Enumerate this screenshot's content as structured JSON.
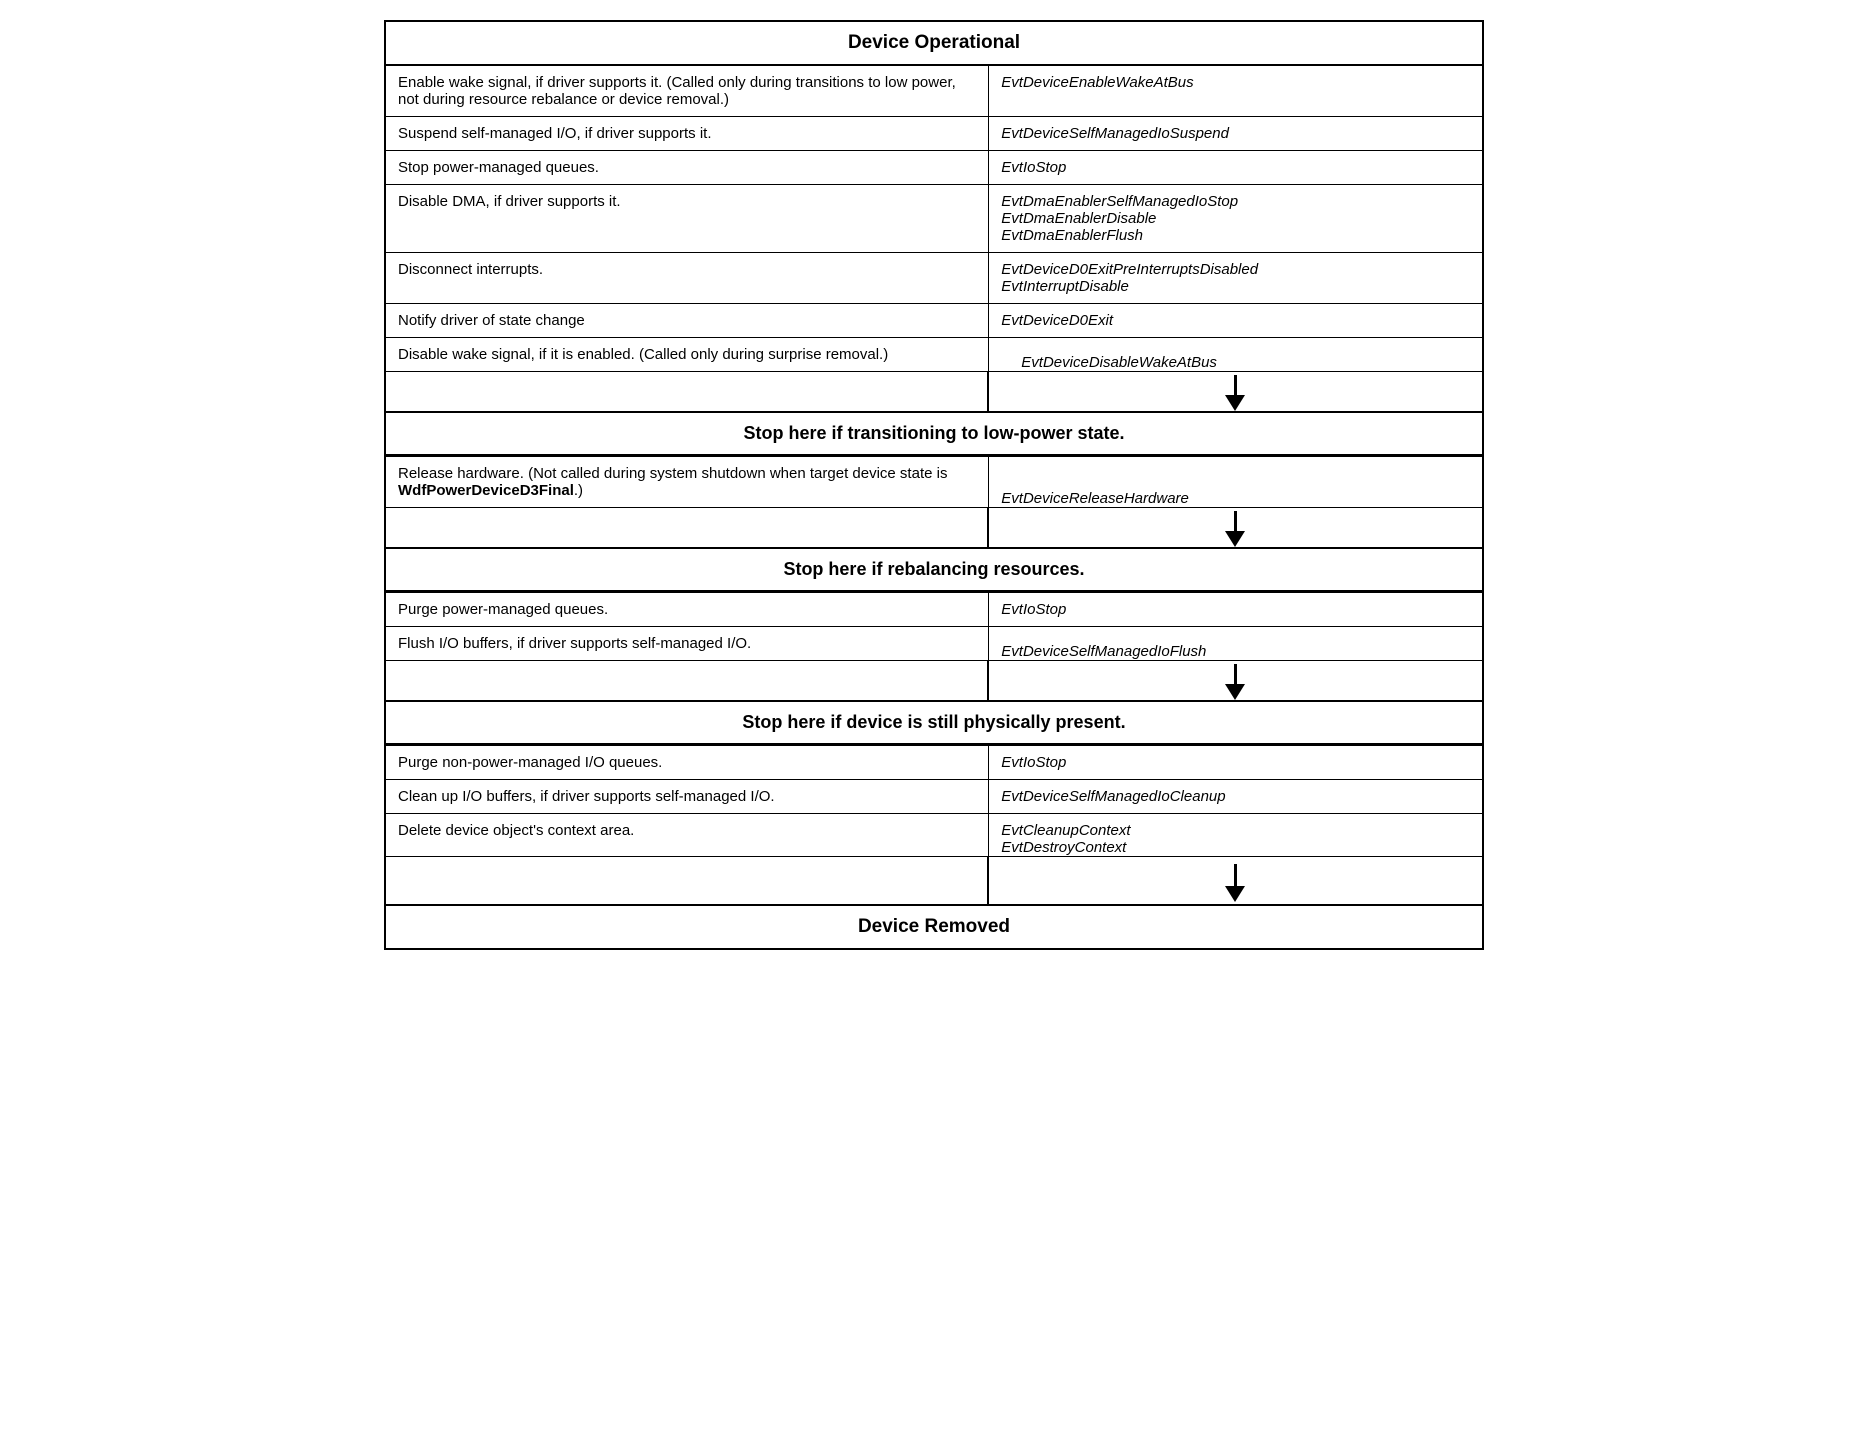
{
  "title": "Device Operational",
  "bottom_title": "Device Removed",
  "sections": {
    "phase1": {
      "rows": [
        {
          "left": "Enable wake signal, if driver supports it. (Called only during transitions to low power, not during resource rebalance or device removal.)",
          "right": "EvtDeviceEnableWakeAtBus",
          "arrow": false
        },
        {
          "left": "Suspend self-managed I/O, if driver supports it.",
          "right": "EvtDeviceSelfManagedIoSuspend",
          "arrow": false
        },
        {
          "left": "Stop power-managed queues.",
          "right": "EvtIoStop",
          "arrow": false
        },
        {
          "left": "Disable DMA, if driver supports it.",
          "right_multi": [
            "EvtDmaEnablerSelfManagedIoStop",
            "EvtDmaEnablerDisable",
            "EvtDmaEnablerFlush"
          ],
          "arrow": false
        },
        {
          "left": "Disconnect interrupts.",
          "right_multi": [
            "EvtDeviceD0ExitPreInterruptsDisabled",
            "EvtInterruptDisable"
          ],
          "arrow": false
        },
        {
          "left": "Notify driver of state change",
          "right": "EvtDeviceD0Exit",
          "arrow": false
        },
        {
          "left": "Disable wake signal, if it is enabled. (Called only during surprise removal.)",
          "right": "EvtDeviceDisableWakeAtBus",
          "arrow": true
        }
      ]
    },
    "stop1": "Stop here if transitioning to low-power state.",
    "phase2": {
      "rows": [
        {
          "left": "Release hardware. (Not called during system shutdown when target device state is WdfPowerDeviceD3Final.)",
          "left_bold": "WdfPowerDeviceD3Final",
          "right": "EvtDeviceReleaseHardware",
          "arrow": true
        }
      ]
    },
    "stop2": "Stop here if rebalancing resources.",
    "phase3": {
      "rows": [
        {
          "left": "Purge power-managed queues.",
          "right": "EvtIoStop",
          "arrow": false
        },
        {
          "left": "Flush I/O buffers, if driver supports self-managed I/O.",
          "right": "EvtDeviceSelfManagedIoFlush",
          "arrow": true
        }
      ]
    },
    "stop3": "Stop here if device is still physically present.",
    "phase4": {
      "rows": [
        {
          "left": "Purge non-power-managed I/O queues.",
          "right": "EvtIoStop",
          "arrow": false
        },
        {
          "left": "Clean up I/O buffers, if driver supports self-managed I/O.",
          "right": "EvtDeviceSelfManagedIoCleanup",
          "arrow": false
        },
        {
          "left": "Delete device object's context area.",
          "right_multi": [
            "EvtCleanupContext",
            "EvtDestroyContext"
          ],
          "arrow": true
        }
      ]
    }
  }
}
